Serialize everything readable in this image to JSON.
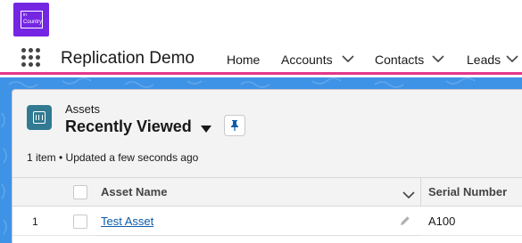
{
  "logo": {
    "line1": "in",
    "line2": "Country",
    "icon": "incountry-logo"
  },
  "navbar": {
    "launcher_icon": "app-launcher-grid-icon",
    "app_name": "Replication Demo",
    "items": [
      {
        "label": "Home",
        "has_menu": false
      },
      {
        "label": "Accounts",
        "has_menu": true
      },
      {
        "label": "Contacts",
        "has_menu": true
      },
      {
        "label": "Leads",
        "has_menu": true
      }
    ],
    "accent_color": "#e4378b"
  },
  "list_view": {
    "object_icon": "asset-icon",
    "breadcrumb": "Assets",
    "title": "Recently Viewed",
    "pin_icon": "pin-icon",
    "status": "1 item • Updated a few seconds ago"
  },
  "table": {
    "columns": [
      {
        "label": "Asset Name",
        "sortable_menu": true
      },
      {
        "label": "Serial Number",
        "sortable_menu": false
      }
    ],
    "rows": [
      {
        "number": "1",
        "asset_name": "Test Asset",
        "serial_number": "A100"
      }
    ]
  },
  "colors": {
    "brand_purple": "#7526e3",
    "background_blue": "#3f93e6",
    "link_blue": "#0b5cab",
    "object_icon_teal": "#317a92"
  }
}
